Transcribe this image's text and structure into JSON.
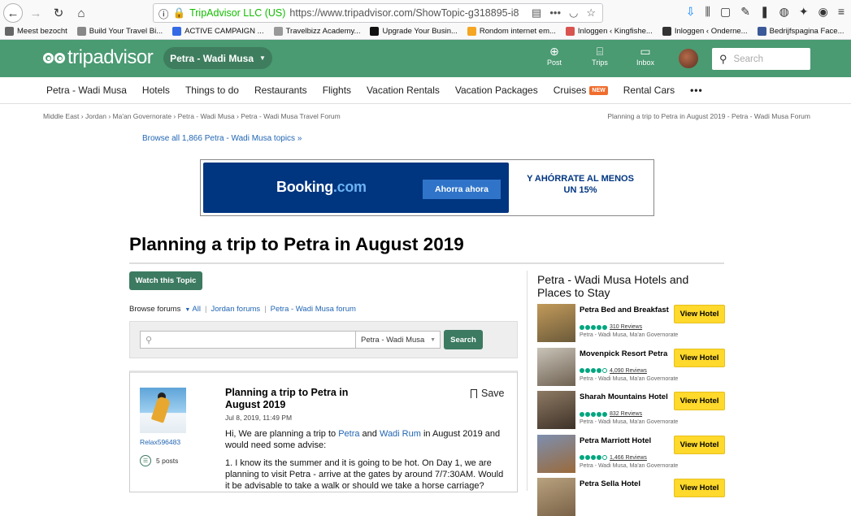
{
  "browser": {
    "site_identity": "TripAdvisor LLC (US)",
    "url": "https://www.tripadvisor.com/ShowTopic-g318895-i8",
    "bookmarks": [
      {
        "label": "Meest bezocht",
        "color": "#666"
      },
      {
        "label": "Build Your Travel Bi...",
        "color": "#888"
      },
      {
        "label": "ACTIVE CAMPAIGN ...",
        "color": "#356ae6"
      },
      {
        "label": "Travelbizz Academy...",
        "color": "#999"
      },
      {
        "label": "Upgrade Your Busin...",
        "color": "#111"
      },
      {
        "label": "Rondom internet em...",
        "color": "#f5a623"
      },
      {
        "label": "Inloggen ‹ Kingfishe...",
        "color": "#d9534f"
      },
      {
        "label": "Inloggen ‹ Onderne...",
        "color": "#333"
      },
      {
        "label": "Bedrijfspagina Face...",
        "color": "#3b5998"
      }
    ]
  },
  "header": {
    "logo_text": "tripadvisor",
    "location_pill": "Petra - Wadi Musa",
    "icons": [
      {
        "label": "Post",
        "icon": "plus-circle-icon",
        "glyph": "⊕"
      },
      {
        "label": "Trips",
        "icon": "suitcase-icon",
        "glyph": "⌸"
      },
      {
        "label": "Inbox",
        "icon": "chat-icon",
        "glyph": "▭"
      }
    ],
    "search_placeholder": "Search"
  },
  "subnav": {
    "items": [
      "Petra - Wadi Musa",
      "Hotels",
      "Things to do",
      "Restaurants",
      "Flights",
      "Vacation Rentals",
      "Vacation Packages"
    ],
    "cruises": "Cruises",
    "new_badge": "NEW",
    "rental_cars": "Rental Cars",
    "more": "•••"
  },
  "breadcrumb": {
    "items": [
      "Middle East",
      "Jordan",
      "Ma'an Governorate",
      "Petra - Wadi Musa",
      "Petra - Wadi Musa Travel Forum"
    ],
    "right": "Planning a trip to Petra in August 2019 - Petra - Wadi Musa Forum"
  },
  "browse_all": "Browse all 1,866 Petra - Wadi Musa topics »",
  "ad": {
    "brand": "Booking",
    "brand_suffix": ".com",
    "cta": "Ahorra ahora",
    "promo": "Y AHÓRRATE AL MENOS UN 15%"
  },
  "topic": {
    "title": "Planning a trip to Petra in August 2019",
    "watch_button": "Watch this Topic",
    "browse_forums_label": "Browse forums",
    "forum_all": "All",
    "forum_jordan": "Jordan forums",
    "forum_petra": "Petra - Wadi Musa forum",
    "search_scope": "Petra - Wadi Musa",
    "search_button": "Search"
  },
  "post": {
    "username": "Relax596483",
    "posts_count": "5 posts",
    "title": "Planning a trip to Petra in August 2019",
    "save": "Save",
    "date": "Jul 8, 2019, 11:49 PM",
    "intro_a": "Hi, We are planning a trip to ",
    "link_petra": "Petra",
    "intro_b": " and ",
    "link_wadi_rum": "Wadi Rum",
    "intro_c": " in August 2019 and would need some advise:",
    "para2": "1. I know its the summer and it is going to be hot. On Day 1, we are planning to visit Petra - arrive at the gates by around 7/7:30AM. Would it be advisable to take a walk or should we take a horse carriage?"
  },
  "sidebar": {
    "title": "Petra - Wadi Musa Hotels and Places to Stay",
    "view_hotel": "View Hotel",
    "hotels": [
      {
        "name": "Petra Bed and Breakfast",
        "reviews": "310 Reviews",
        "location": "Petra - Wadi Musa, Ma'an Governorate",
        "bubbles": 5,
        "c1": "#c29a5a",
        "c2": "#6b5a3a"
      },
      {
        "name": "Movenpick Resort Petra",
        "reviews": "4,090 Reviews",
        "location": "Petra - Wadi Musa, Ma'an Governorate",
        "bubbles": 4,
        "c1": "#c9c3b8",
        "c2": "#6f6252"
      },
      {
        "name": "Sharah Mountains Hotel",
        "reviews": "832 Reviews",
        "location": "Petra - Wadi Musa, Ma'an Governorate",
        "bubbles": 5,
        "c1": "#8e7a64",
        "c2": "#3e3228"
      },
      {
        "name": "Petra Marriott Hotel",
        "reviews": "1,466 Reviews",
        "location": "Petra - Wadi Musa, Ma'an Governorate",
        "bubbles": 4,
        "c1": "#7d8fb0",
        "c2": "#9a6a3a"
      },
      {
        "name": "Petra Sella Hotel",
        "reviews": "",
        "location": "",
        "bubbles": 0,
        "c1": "#b9a27e",
        "c2": "#7a6248"
      }
    ]
  }
}
